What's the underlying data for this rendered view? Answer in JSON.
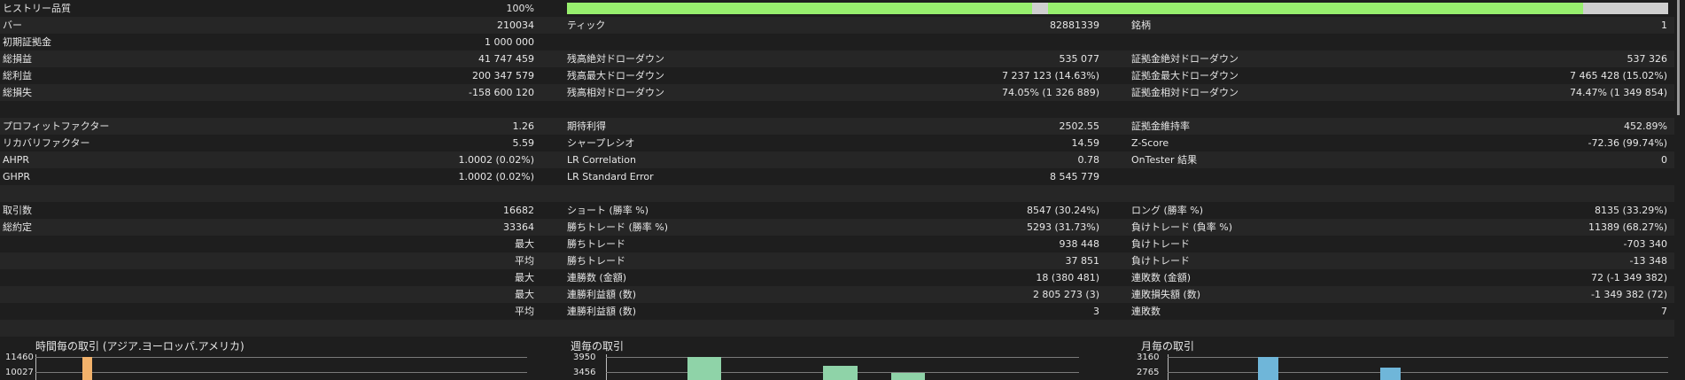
{
  "quality": {
    "label": "ヒストリー品質",
    "value": "100%"
  },
  "rows": [
    {
      "c1l": "バー",
      "c1v": "210034",
      "c2l": "ティック",
      "c2v": "82881339",
      "c3l": "銘柄",
      "c3v": "1"
    },
    {
      "c1l": "初期証拠金",
      "c1v": "1 000 000",
      "c2l": "",
      "c2v": "",
      "c3l": "",
      "c3v": ""
    },
    {
      "c1l": "総損益",
      "c1v": "41 747 459",
      "c2l": "残高絶対ドローダウン",
      "c2v": "535 077",
      "c3l": "証拠金絶対ドローダウン",
      "c3v": "537 326"
    },
    {
      "c1l": "総利益",
      "c1v": "200 347 579",
      "c2l": "残高最大ドローダウン",
      "c2v": "7 237 123 (14.63%)",
      "c3l": "証拠金最大ドローダウン",
      "c3v": "7 465 428 (15.02%)"
    },
    {
      "c1l": "総損失",
      "c1v": "-158 600 120",
      "c2l": "残高相対ドローダウン",
      "c2v": "74.05% (1 326 889)",
      "c3l": "証拠金相対ドローダウン",
      "c3v": "74.47% (1 349 854)"
    },
    {
      "c1l": "",
      "c1v": "",
      "c2l": "",
      "c2v": "",
      "c3l": "",
      "c3v": ""
    },
    {
      "c1l": "プロフィットファクター",
      "c1v": "1.26",
      "c2l": "期待利得",
      "c2v": "2502.55",
      "c3l": "証拠金維持率",
      "c3v": "452.89%"
    },
    {
      "c1l": "リカバリファクター",
      "c1v": "5.59",
      "c2l": "シャープレシオ",
      "c2v": "14.59",
      "c3l": "Z-Score",
      "c3v": "-72.36 (99.74%)"
    },
    {
      "c1l": "AHPR",
      "c1v": "1.0002 (0.02%)",
      "c2l": "LR Correlation",
      "c2v": "0.78",
      "c3l": "OnTester 結果",
      "c3v": "0"
    },
    {
      "c1l": "GHPR",
      "c1v": "1.0002 (0.02%)",
      "c2l": "LR Standard Error",
      "c2v": "8 545 779",
      "c3l": "",
      "c3v": ""
    },
    {
      "c1l": "",
      "c1v": "",
      "c2l": "",
      "c2v": "",
      "c3l": "",
      "c3v": ""
    },
    {
      "c1l": "取引数",
      "c1v": "16682",
      "c2l": "ショート (勝率 %)",
      "c2v": "8547 (30.24%)",
      "c3l": "ロング (勝率 %)",
      "c3v": "8135 (33.29%)"
    },
    {
      "c1l": "総約定",
      "c1v": "33364",
      "c2l": "勝ちトレード (勝率 %)",
      "c2v": "5293 (31.73%)",
      "c3l": "負けトレード (負率 %)",
      "c3v": "11389 (68.27%)"
    },
    {
      "c1l": "",
      "c1v": "最大",
      "c2l": "勝ちトレード",
      "c2v": "938 448",
      "c3l": "負けトレード",
      "c3v": "-703 340"
    },
    {
      "c1l": "",
      "c1v": "平均",
      "c2l": "勝ちトレード",
      "c2v": "37 851",
      "c3l": "負けトレード",
      "c3v": "-13 348"
    },
    {
      "c1l": "",
      "c1v": "最大",
      "c2l": "連勝数 (金額)",
      "c2v": "18 (380 481)",
      "c3l": "連敗数 (金額)",
      "c3v": "72 (-1 349 382)"
    },
    {
      "c1l": "",
      "c1v": "最大",
      "c2l": "連勝利益額 (数)",
      "c2v": "2 805 273 (3)",
      "c3l": "連敗損失額 (数)",
      "c3v": "-1 349 382 (72)"
    },
    {
      "c1l": "",
      "c1v": "平均",
      "c2l": "連勝利益額 (数)",
      "c2v": "3",
      "c3l": "連敗数",
      "c3v": "7"
    },
    {
      "c1l": "",
      "c1v": "",
      "c2l": "",
      "c2v": "",
      "c3l": "",
      "c3v": ""
    }
  ],
  "charts": [
    {
      "title": "時間毎の取引 (アジア.ヨーロッパ.アメリカ)",
      "ticks": [
        "11460",
        "10027"
      ],
      "bar_color": "#f2b26b"
    },
    {
      "title": "週毎の取引",
      "ticks": [
        "3950",
        "3456"
      ],
      "bar_color": "#8fd3a8"
    },
    {
      "title": "月毎の取引",
      "ticks": [
        "3160",
        "2765"
      ],
      "bar_color": "#6fb6d9"
    }
  ],
  "colors": {
    "quality_fill": "#98ef6e",
    "quality_gap": "#cfcfcf"
  }
}
